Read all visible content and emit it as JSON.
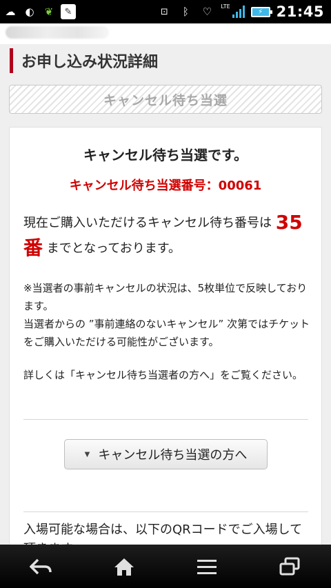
{
  "status_bar": {
    "time": "21:45",
    "network_label": "LTE",
    "colors": {
      "signal": "#3fb8e8",
      "battery": "#3fb8e8"
    }
  },
  "page": {
    "heading": "お申し込み状況詳細",
    "status_label": "キャンセル待ち当選",
    "card": {
      "title": "キャンセル待ち当選です。",
      "number_line": "キャンセル待ち当選番号：00061",
      "purchase_prefix": "現在ご購入いただけるキャンセル待ち番号は",
      "purchase_number": "35",
      "purchase_unit": "番",
      "purchase_suffix": "までとなっております。",
      "note_line1": "※当選者の事前キャンセルの状況は、5枚単位で反映しております。",
      "note_line2": "当選者からの ”事前連絡のないキャンセル” 次第ではチケットをご購入いただける可能性がございます。",
      "details_text": "詳しくは「キャンセル待ち当選者の方へ」をご覧ください。",
      "button_label": "キャンセル待ち当選の方へ",
      "entry_text": "入場可能な場合は、以下のQRコードでご入場して頂きます。"
    },
    "colors": {
      "accent": "#b3001b",
      "highlight": "#d00000"
    }
  },
  "nav_bar": {
    "items": [
      {
        "icon": "back-icon"
      },
      {
        "icon": "home-icon"
      },
      {
        "icon": "menu-icon"
      },
      {
        "icon": "recent-apps-icon"
      }
    ]
  }
}
